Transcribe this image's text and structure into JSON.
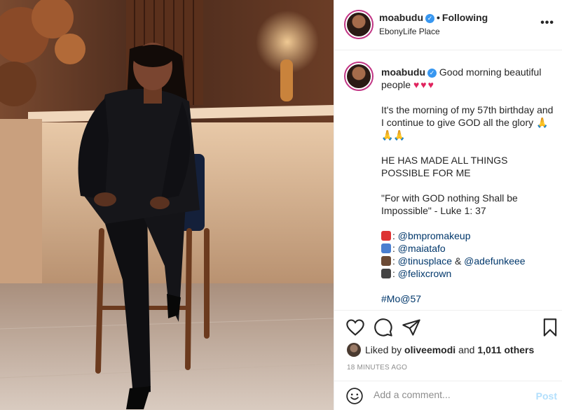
{
  "header": {
    "username": "moabudu",
    "follow_status": "Following",
    "location": "EbonyLife Place",
    "more_label": "•••"
  },
  "caption": {
    "username": "moabudu",
    "greeting": "Good morning beautiful people",
    "hearts": "♥♥♥",
    "para1": "It's the morning of my 57th birthday and I continue to give GOD all the glory",
    "pray": "🙏🙏🙏",
    "para2": "HE HAS MADE ALL THINGS POSSIBLE FOR ME",
    "para3": "\"For with GOD nothing Shall be Impossible\" - Luke 1: 37",
    "credits": [
      {
        "mention": "@bmpromakeup"
      },
      {
        "mention": "@maiatafo"
      },
      {
        "mention": "@tinusplace",
        "joiner": "&",
        "mention2": "@adefunkeee"
      },
      {
        "mention": "@felixcrown"
      }
    ],
    "hashtag": "#Mo@57"
  },
  "likes": {
    "prefix": "Liked by",
    "user": "oliveemodi",
    "and": "and",
    "count": "1,011 others"
  },
  "timestamp": "18 MINUTES AGO",
  "comment": {
    "placeholder": "Add a comment...",
    "post_label": "Post"
  },
  "icons": {
    "like": "heart-icon",
    "comment": "comment-icon",
    "share": "share-icon",
    "save": "bookmark-icon",
    "emoji": "smile-icon"
  },
  "colors": {
    "verified": "#3897f0",
    "mention": "#00376b",
    "post_disabled": "#b2dffc",
    "heart": "#e0245e"
  }
}
